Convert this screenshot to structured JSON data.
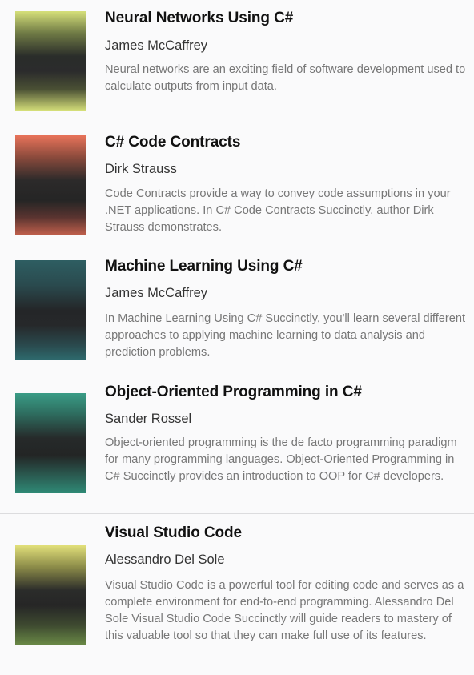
{
  "books": [
    {
      "title": "Neural Networks Using C#",
      "author": "James McCaffrey",
      "description": "Neural networks are an exciting field of software development used to calculate outputs from input data.",
      "cover_accent": "#d6e07a"
    },
    {
      "title": "C# Code Contracts",
      "author": "Dirk Strauss",
      "description": "Code Contracts provide a way to convey code assumptions in your .NET applications. In C# Code Contracts Succinctly, author Dirk Strauss demonstrates.",
      "cover_accent": "#e8735a"
    },
    {
      "title": "Machine Learning Using C#",
      "author": "James McCaffrey",
      "description": "In Machine Learning Using C# Succinctly, you'll learn several different approaches to applying machine learning to data analysis and prediction problems.",
      "cover_accent": "#2e6b6e"
    },
    {
      "title": "Object-Oriented Programming in C#",
      "author": "Sander Rossel",
      "description": "Object-oriented programming is the de facto programming paradigm for many programming languages. Object-Oriented Programming in C# Succinctly provides an introduction to OOP for C# developers.",
      "cover_accent": "#3a9c86"
    },
    {
      "title": "Visual Studio Code",
      "author": "Alessandro Del Sole",
      "description": "Visual Studio Code is a powerful tool for editing code and serves as a complete environment for end-to-end programming. Alessandro Del Sole Visual Studio Code Succinctly will guide readers to mastery of this valuable tool so that they can make full use of its features.",
      "cover_accent": "#e2e07a"
    }
  ]
}
